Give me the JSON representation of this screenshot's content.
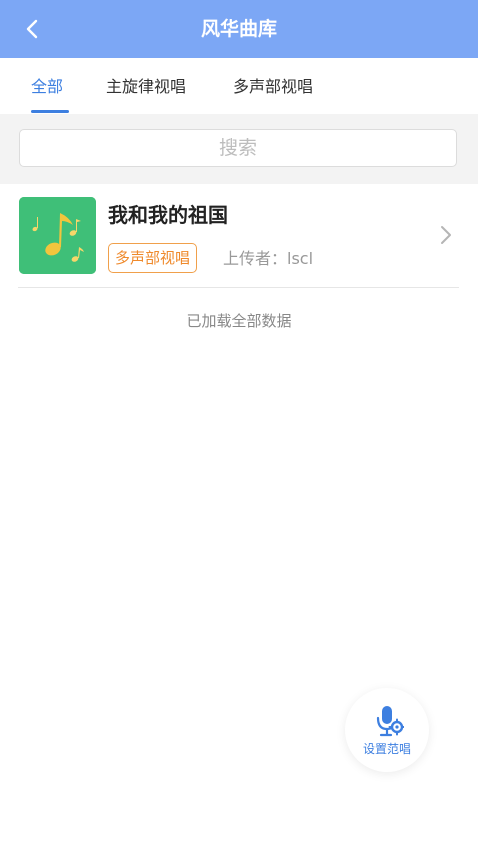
{
  "header": {
    "title": "风华曲库",
    "back_icon": "chevron-left-icon"
  },
  "tabs": [
    {
      "label": "全部",
      "active": true
    },
    {
      "label": "主旋律视唱",
      "active": false
    },
    {
      "label": "多声部视唱",
      "active": false
    }
  ],
  "search": {
    "placeholder": "搜索"
  },
  "songs": [
    {
      "title": "我和我的祖国",
      "tag": "多声部视唱",
      "uploader": "上传者：lscl",
      "cover_icon": "music-notes-icon"
    }
  ],
  "list_status": "已加载全部数据",
  "fab": {
    "label": "设置范唱",
    "icon": "microphone-settings-icon"
  },
  "colors": {
    "header_bg": "#7ca7f5",
    "accent": "#3d7fe0",
    "tag_orange": "#ef8a2c",
    "cover_green": "#3fbf78"
  }
}
